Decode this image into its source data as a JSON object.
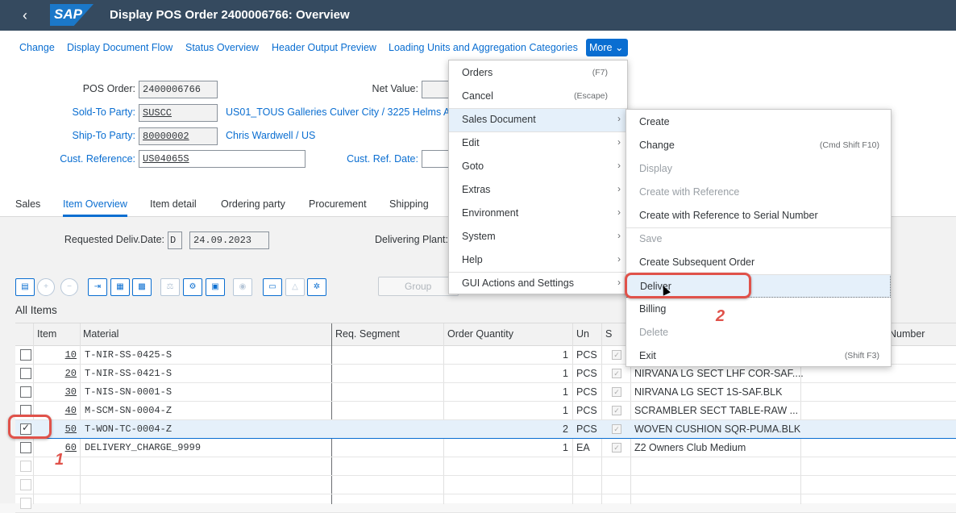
{
  "shell": {
    "title": "Display POS Order 2400006766: Overview",
    "logo": "SAP",
    "back_icon": "chevron-left-icon"
  },
  "toolbar": {
    "buttons": [
      "Change",
      "Display Document Flow",
      "Status Overview",
      "Header Output Preview",
      "Loading Units and Aggregation Categories"
    ],
    "more": "More"
  },
  "header": {
    "pos_order_label": "POS Order:",
    "pos_order": "2400006766",
    "sold_to_label": "Sold-To Party:",
    "sold_to": "SUSCC",
    "sold_to_text": "US01_TOUS Galleries Culver City / 3225 Helms A",
    "ship_to_label": "Ship-To Party:",
    "ship_to": "80000002",
    "ship_to_text": "Chris Wardwell / US",
    "cust_ref_label": "Cust. Reference:",
    "cust_ref": "US04065S",
    "net_value_label": "Net Value:",
    "cust_ref_date_label": "Cust. Ref. Date:"
  },
  "tabs": [
    "Sales",
    "Item Overview",
    "Item detail",
    "Ordering party",
    "Procurement",
    "Shipping"
  ],
  "itemarea": {
    "req_deliv_label": "Requested Deliv.Date:",
    "req_deliv_type": "D",
    "req_deliv_date": "24.09.2023",
    "deliv_plant_label": "Delivering Plant:",
    "group_label": "Group",
    "all_items": "All Items"
  },
  "grid": {
    "headers": {
      "item": "Item",
      "material": "Material",
      "req_segment": "Req. Segment",
      "order_qty": "Order Quantity",
      "un": "Un",
      "s": "S",
      "number": "Number"
    },
    "rows": [
      {
        "item": "10",
        "material": "T-NIR-SS-0425-S",
        "qty": "1",
        "un": "PCS",
        "desc": "",
        "selected": false
      },
      {
        "item": "20",
        "material": "T-NIR-SS-0421-S",
        "qty": "1",
        "un": "PCS",
        "desc": "NIRVANA LG SECT LHF COR-SAF....",
        "selected": false
      },
      {
        "item": "30",
        "material": "T-NIS-SN-0001-S",
        "qty": "1",
        "un": "PCS",
        "desc": "NIRVANA LG SECT 1S-SAF.BLK",
        "selected": false
      },
      {
        "item": "40",
        "material": "M-SCM-SN-0004-Z",
        "qty": "1",
        "un": "PCS",
        "desc": "SCRAMBLER SECT TABLE-RAW ...",
        "selected": false
      },
      {
        "item": "50",
        "material": "T-WON-TC-0004-Z",
        "qty": "2",
        "un": "PCS",
        "desc": "WOVEN CUSHION SQR-PUMA.BLK",
        "selected": true
      },
      {
        "item": "60",
        "material": "DELIVERY_CHARGE_9999",
        "qty": "1",
        "un": "EA",
        "desc": "Z2 Owners Club Medium",
        "selected": false
      }
    ]
  },
  "more_menu": {
    "items": [
      {
        "label": "Orders",
        "shortcut": "(F7)"
      },
      {
        "label": "Cancel",
        "shortcut": "(Escape)"
      },
      {
        "label": "Sales Document",
        "shortcut": ""
      },
      {
        "label": "Edit",
        "shortcut": ""
      },
      {
        "label": "Goto",
        "shortcut": ""
      },
      {
        "label": "Extras",
        "shortcut": ""
      },
      {
        "label": "Environment",
        "shortcut": ""
      },
      {
        "label": "System",
        "shortcut": ""
      },
      {
        "label": "Help",
        "shortcut": ""
      },
      {
        "label": "GUI Actions and Settings",
        "shortcut": ""
      }
    ]
  },
  "sub_menu": {
    "items": [
      {
        "label": "Create",
        "shortcut": ""
      },
      {
        "label": "Change",
        "shortcut": "(Cmd Shift F10)"
      },
      {
        "label": "Display",
        "shortcut": ""
      },
      {
        "label": "Create with Reference",
        "shortcut": ""
      },
      {
        "label": "Create with Reference to Serial Number",
        "shortcut": ""
      },
      {
        "label": "Save",
        "shortcut": ""
      },
      {
        "label": "Create Subsequent Order",
        "shortcut": ""
      },
      {
        "label": "Deliver",
        "shortcut": ""
      },
      {
        "label": "Billing",
        "shortcut": ""
      },
      {
        "label": "Delete",
        "shortcut": ""
      },
      {
        "label": "Exit",
        "shortcut": "(Shift F3)"
      }
    ]
  },
  "annotations": {
    "step1": "1",
    "step2": "2",
    "color": "#e0524a"
  }
}
